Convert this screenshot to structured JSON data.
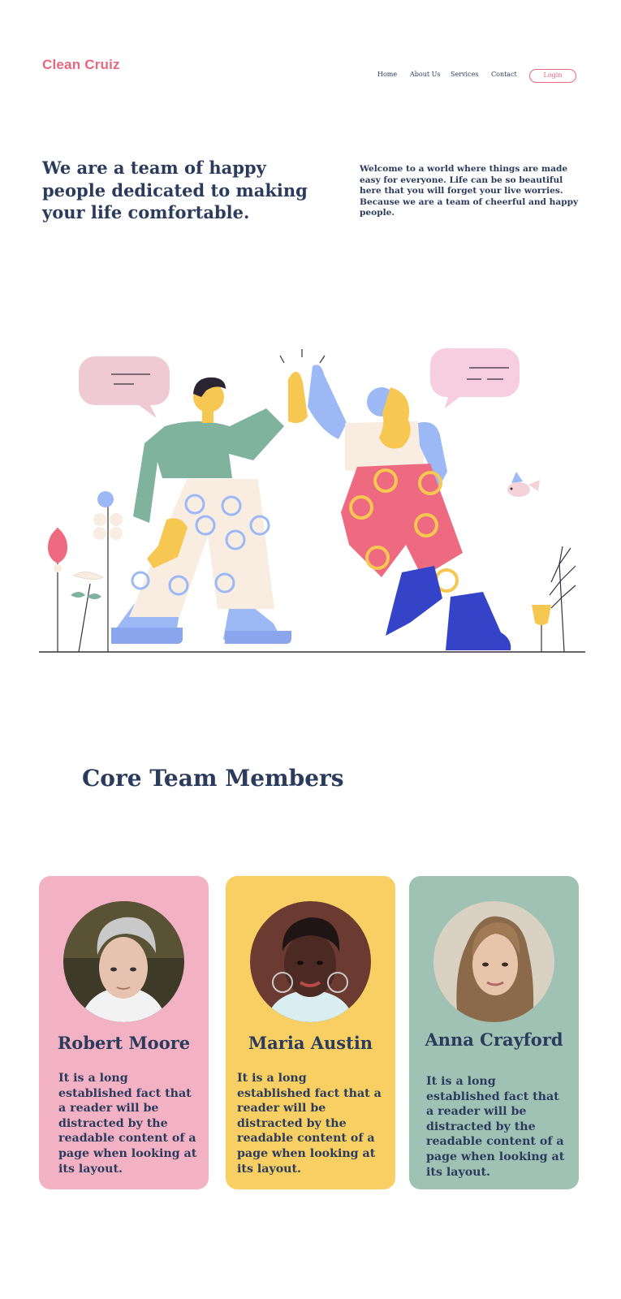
{
  "brand": {
    "logo": "Clean Cruiz",
    "accent": "#e8677f",
    "text_color": "#2b3b5c"
  },
  "nav": {
    "items": [
      "Home",
      "About Us",
      "Services",
      "Contact"
    ],
    "login_label": "Login"
  },
  "hero": {
    "title": "We are a team of happy people dedicated to making your life comfortable.",
    "description": "Welcome to a world where things are made easy for everyone. Life can be so beautiful here that you will forget your live worries. Because we are a team of cheerful and happy people."
  },
  "illustration": {
    "icon": "high-five-illustration"
  },
  "team": {
    "title": "Core Team Members",
    "members": [
      {
        "name": "Robert Moore",
        "bio": "It is a long established fact that a reader will be distracted by the readable content of a page when looking at its layout.",
        "color": "#f3b1c4"
      },
      {
        "name": "Maria Austin",
        "bio": "It is a long established fact that a reader will be distracted by the readable content of a page when looking at its layout.",
        "color": "#f7cf62"
      },
      {
        "name": "Anna Crayford",
        "bio": "It is a long established fact that a reader will be distracted by the readable content of a page when looking at its layout.",
        "color": "#a0c2b5"
      }
    ]
  }
}
